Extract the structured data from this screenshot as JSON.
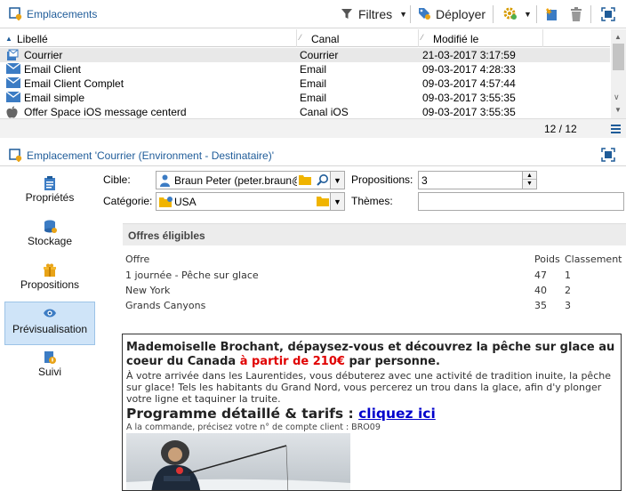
{
  "topbar": {
    "title": "Emplacements",
    "filters_label": "Filtres",
    "deploy_label": "Déployer"
  },
  "list": {
    "columns": [
      "Libellé",
      "Canal",
      "Modifié le"
    ],
    "rows": [
      {
        "label": "Courrier",
        "canal": "Courrier",
        "date": "21-03-2017 3:17:59",
        "icon": "mail-doc-icon"
      },
      {
        "label": "Email Client",
        "canal": "Email",
        "date": "09-03-2017 4:28:33",
        "icon": "email-icon"
      },
      {
        "label": "Email Client Complet",
        "canal": "Email",
        "date": "09-03-2017 4:57:44",
        "icon": "email-icon"
      },
      {
        "label": "Email simple",
        "canal": "Email",
        "date": "09-03-2017 3:55:35",
        "icon": "email-icon"
      },
      {
        "label": "Offer Space iOS message centerd",
        "canal": "Canal iOS",
        "date": "09-03-2017 3:55:35",
        "icon": "apple-icon"
      }
    ],
    "count": "12 / 12"
  },
  "detail": {
    "title": "Emplacement 'Courrier (Environment - Destinataire)'"
  },
  "nav": {
    "items": [
      "Propriétés",
      "Stockage",
      "Propositions",
      "Prévisualisation",
      "Suivi"
    ]
  },
  "form": {
    "cible_label": "Cible:",
    "cible_value": "Braun Peter (peter.braun@",
    "categorie_label": "Catégorie:",
    "categorie_value": "USA",
    "propositions_label": "Propositions:",
    "propositions_value": "3",
    "themes_label": "Thèmes:"
  },
  "offres": {
    "heading": "Offres éligibles",
    "columns": [
      "Offre",
      "Poids",
      "Classement"
    ],
    "rows": [
      {
        "offre": "1 journée - Pêche sur glace",
        "poids": "47",
        "classement": "1"
      },
      {
        "offre": "New York",
        "poids": "40",
        "classement": "2"
      },
      {
        "offre": "Grands Canyons",
        "poids": "35",
        "classement": "3"
      }
    ]
  },
  "preview": {
    "headline_1": "Mademoiselle Brochant, dépaysez-vous et découvrez la pêche sur glace au coeur du Canada ",
    "headline_price": "à partir de 210€",
    "headline_2": " par personne.",
    "body": "À votre arrivée dans les Laurentides, vous débuterez avec une activité de tradition inuite, la pêche sur glace! Tels les habitants du Grand Nord, vous percerez un trou dans la glace, afin d'y plonger votre ligne et taquiner la truite.",
    "programme": "Programme détaillé & tarifs : ",
    "link": "cliquez ici",
    "small": "A la commande, précisez votre n° de compte client : BRO09"
  },
  "colors": {
    "accent": "#1f5c99",
    "price_red": "#e00000",
    "link_blue": "#0000cc",
    "nav_active_bg": "#cfe4f8"
  }
}
